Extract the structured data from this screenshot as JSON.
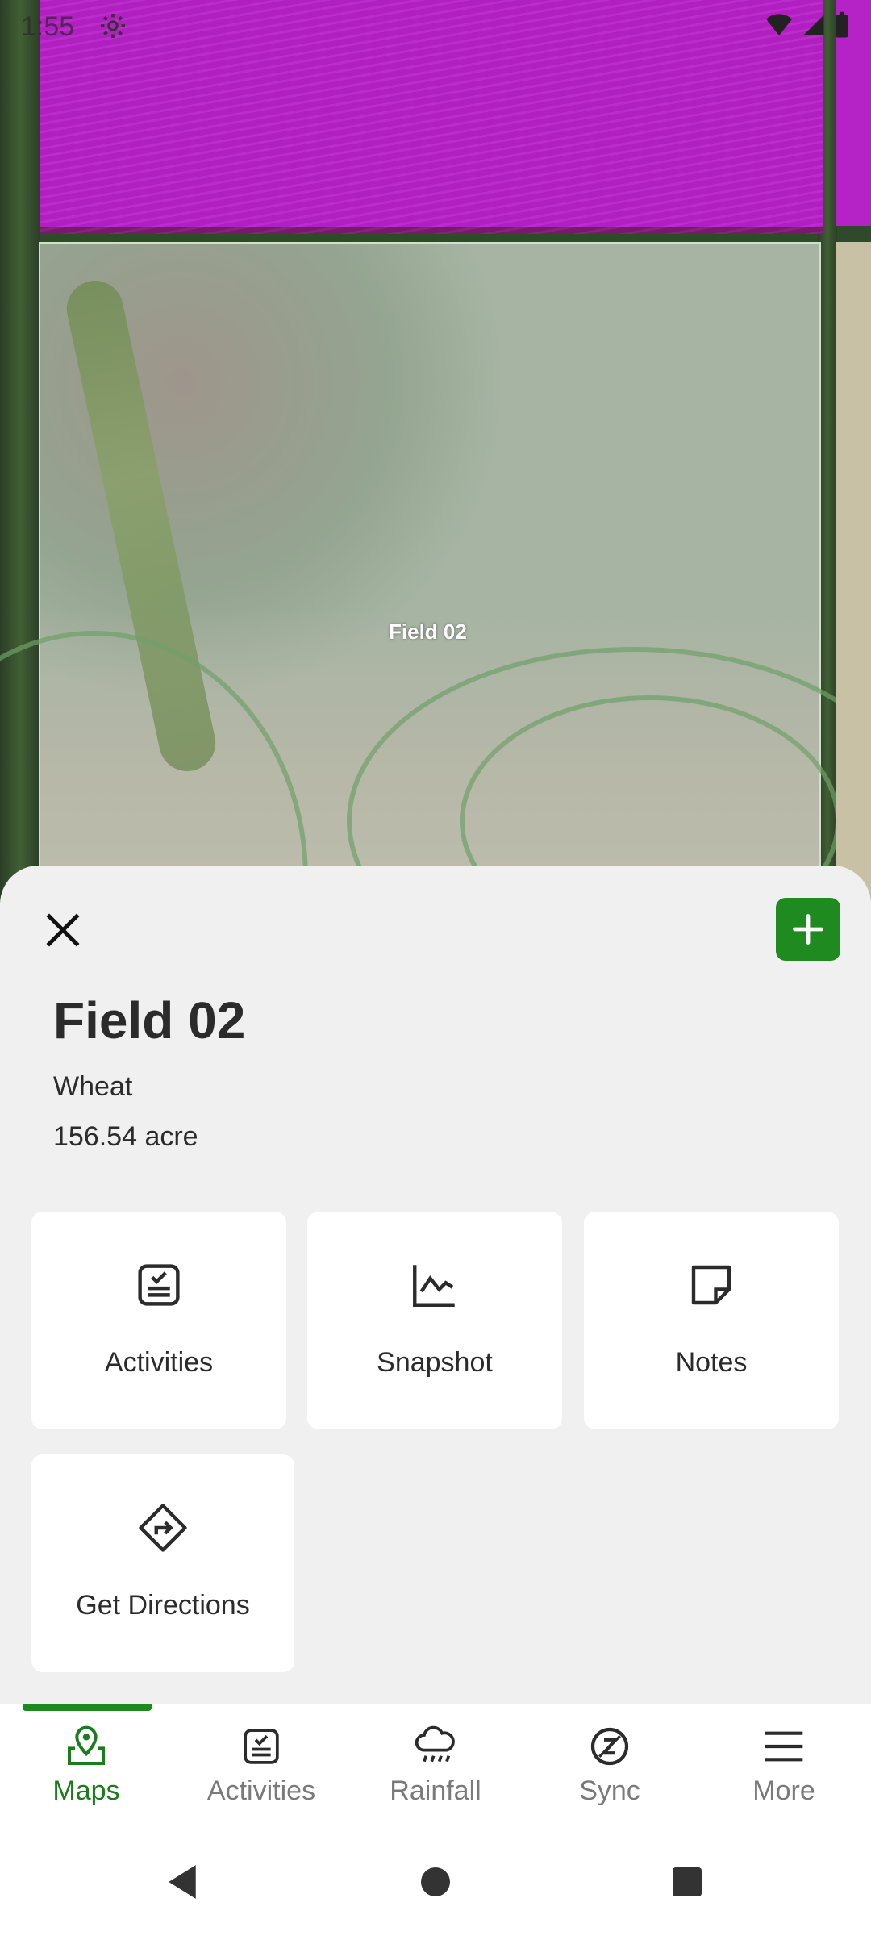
{
  "status_bar": {
    "time": "1:55"
  },
  "map": {
    "field_label": "Field 02"
  },
  "sheet": {
    "title": "Field 02",
    "crop": "Wheat",
    "area": "156.54 acre",
    "actions": [
      {
        "label": "Activities",
        "icon": "activities-icon"
      },
      {
        "label": "Snapshot",
        "icon": "snapshot-chart-icon"
      },
      {
        "label": "Notes",
        "icon": "notes-icon"
      },
      {
        "label": "Get Directions",
        "icon": "directions-icon"
      }
    ]
  },
  "nav": {
    "active": "Maps",
    "items": [
      {
        "label": "Maps",
        "icon": "map-pin-icon"
      },
      {
        "label": "Activities",
        "icon": "activities-icon"
      },
      {
        "label": "Rainfall",
        "icon": "rain-cloud-icon"
      },
      {
        "label": "Sync",
        "icon": "sync-icon"
      },
      {
        "label": "More",
        "icon": "menu-icon"
      }
    ]
  },
  "colors": {
    "accent_green": "#1f8a1f",
    "field_highlight": "#b820c8",
    "sheet_bg": "#f0f0f0"
  }
}
